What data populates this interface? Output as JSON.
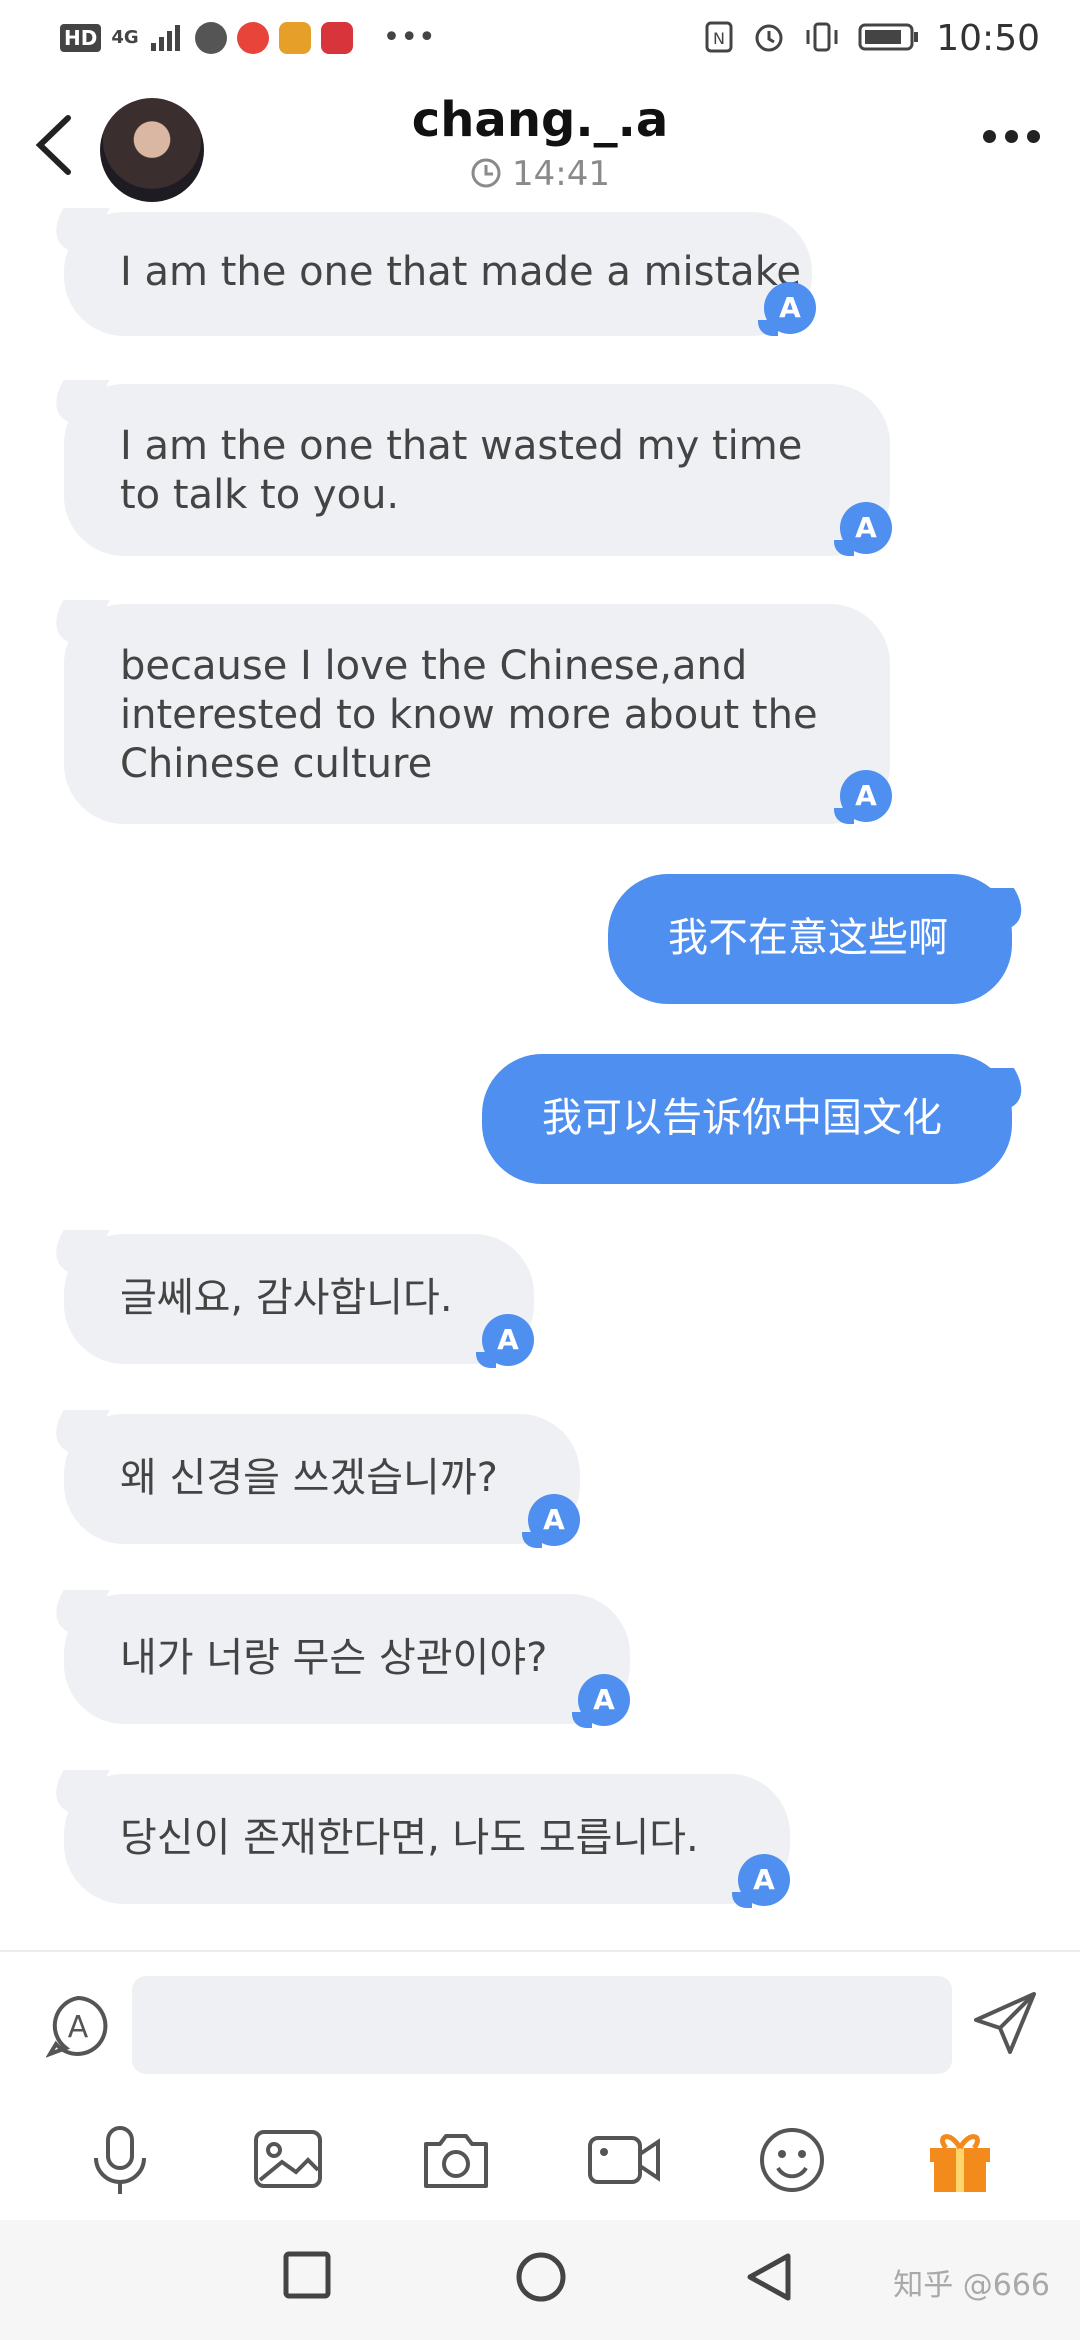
{
  "status_bar": {
    "time": "10:50",
    "network": "4G"
  },
  "header": {
    "contact_name": "chang._.a",
    "subtitle_time": "14:41"
  },
  "messages": [
    {
      "dir": "in",
      "text": "I am the one that made a mistake",
      "translate_badge": "A"
    },
    {
      "dir": "in",
      "text": "I am the one that wasted my time to talk to you.",
      "translate_badge": "A"
    },
    {
      "dir": "in",
      "text": "because I love the Chinese,and interested to know more about the Chinese culture",
      "translate_badge": "A"
    },
    {
      "dir": "out",
      "text": "我不在意这些啊"
    },
    {
      "dir": "out",
      "text": "我可以告诉你中国文化"
    },
    {
      "dir": "in",
      "text": "글쎄요, 감사합니다.",
      "translate_badge": "A"
    },
    {
      "dir": "in",
      "text": "왜 신경을 쓰겠습니까?",
      "translate_badge": "A"
    },
    {
      "dir": "in",
      "text": "내가 너랑 무슨 상관이야?",
      "translate_badge": "A"
    },
    {
      "dir": "in",
      "text": "당신이 존재한다면, 나도 모릅니다.",
      "translate_badge": "A"
    }
  ],
  "composer": {
    "placeholder": "",
    "translate_icon": "translate-icon",
    "send_icon": "send-icon"
  },
  "toolbar": [
    "microphone-icon",
    "image-icon",
    "camera-icon",
    "video-icon",
    "emoji-icon",
    "gift-icon"
  ],
  "colors": {
    "accent": "#4f8ff0",
    "incoming_bubble": "#eef0f4",
    "gift": "#f28a1c"
  },
  "watermark": "知乎 @666"
}
